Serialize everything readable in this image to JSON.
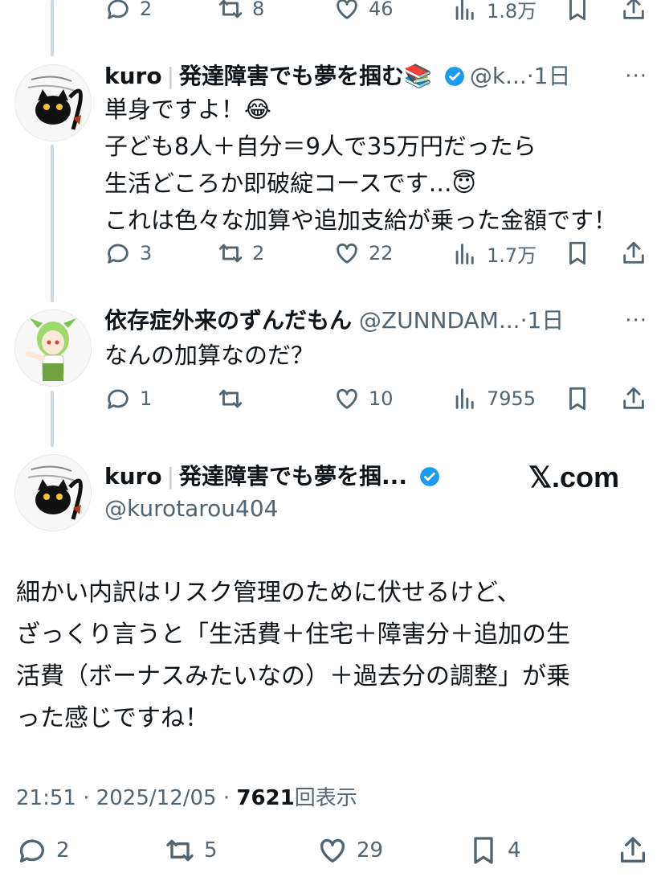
{
  "top_actions": {
    "reply": "2",
    "repost": "8",
    "like": "46",
    "views": "1.8万"
  },
  "tweet1": {
    "name": "kuro",
    "sep": "|",
    "display_suffix": "発達障害でも夢を掴む📚",
    "handle": "@k...",
    "time": "·1日",
    "lines": [
      "単身ですよ！😂",
      "子ども8人＋自分＝9人で35万円だったら",
      "生活どころか即破綻コースです…😇",
      "これは色々な加算や追加支給が乗った金額です！"
    ],
    "reply": "3",
    "repost": "2",
    "like": "22",
    "views": "1.7万"
  },
  "tweet2": {
    "name": "依存症外来のずんだもん",
    "handle": "@ZUNNDAM...",
    "time": "·1日",
    "lines": [
      "なんの加算なのだ？"
    ],
    "reply": "1",
    "repost": "",
    "like": "10",
    "views": "7955"
  },
  "main": {
    "name": "kuro",
    "sep": "|",
    "display_suffix": "発達障害でも夢を掴...",
    "handle": "@kurotarou404",
    "watermark": "𝕏.com",
    "lines": [
      "細かい内訳はリスク管理のために伏せるけど、",
      "ざっくり言うと「生活費＋住宅＋障害分＋追加の生",
      "活費（ボーナスみたいなの）＋過去分の調整」が乗",
      "った感じですね！"
    ],
    "time_date": "21:51 · 2025/12/05 · ",
    "views_count": "7621",
    "views_label": "回表示",
    "reply": "2",
    "repost": "5",
    "like": "29",
    "bookmark": "4"
  },
  "colors": {
    "verified": "#1d9bf0",
    "text": "#0f1419",
    "muted": "#536471",
    "thread": "#cfd9de"
  },
  "icons": [
    "reply-icon",
    "repost-icon",
    "like-icon",
    "views-icon",
    "bookmark-icon",
    "share-icon",
    "more-icon",
    "verified-badge-icon"
  ]
}
